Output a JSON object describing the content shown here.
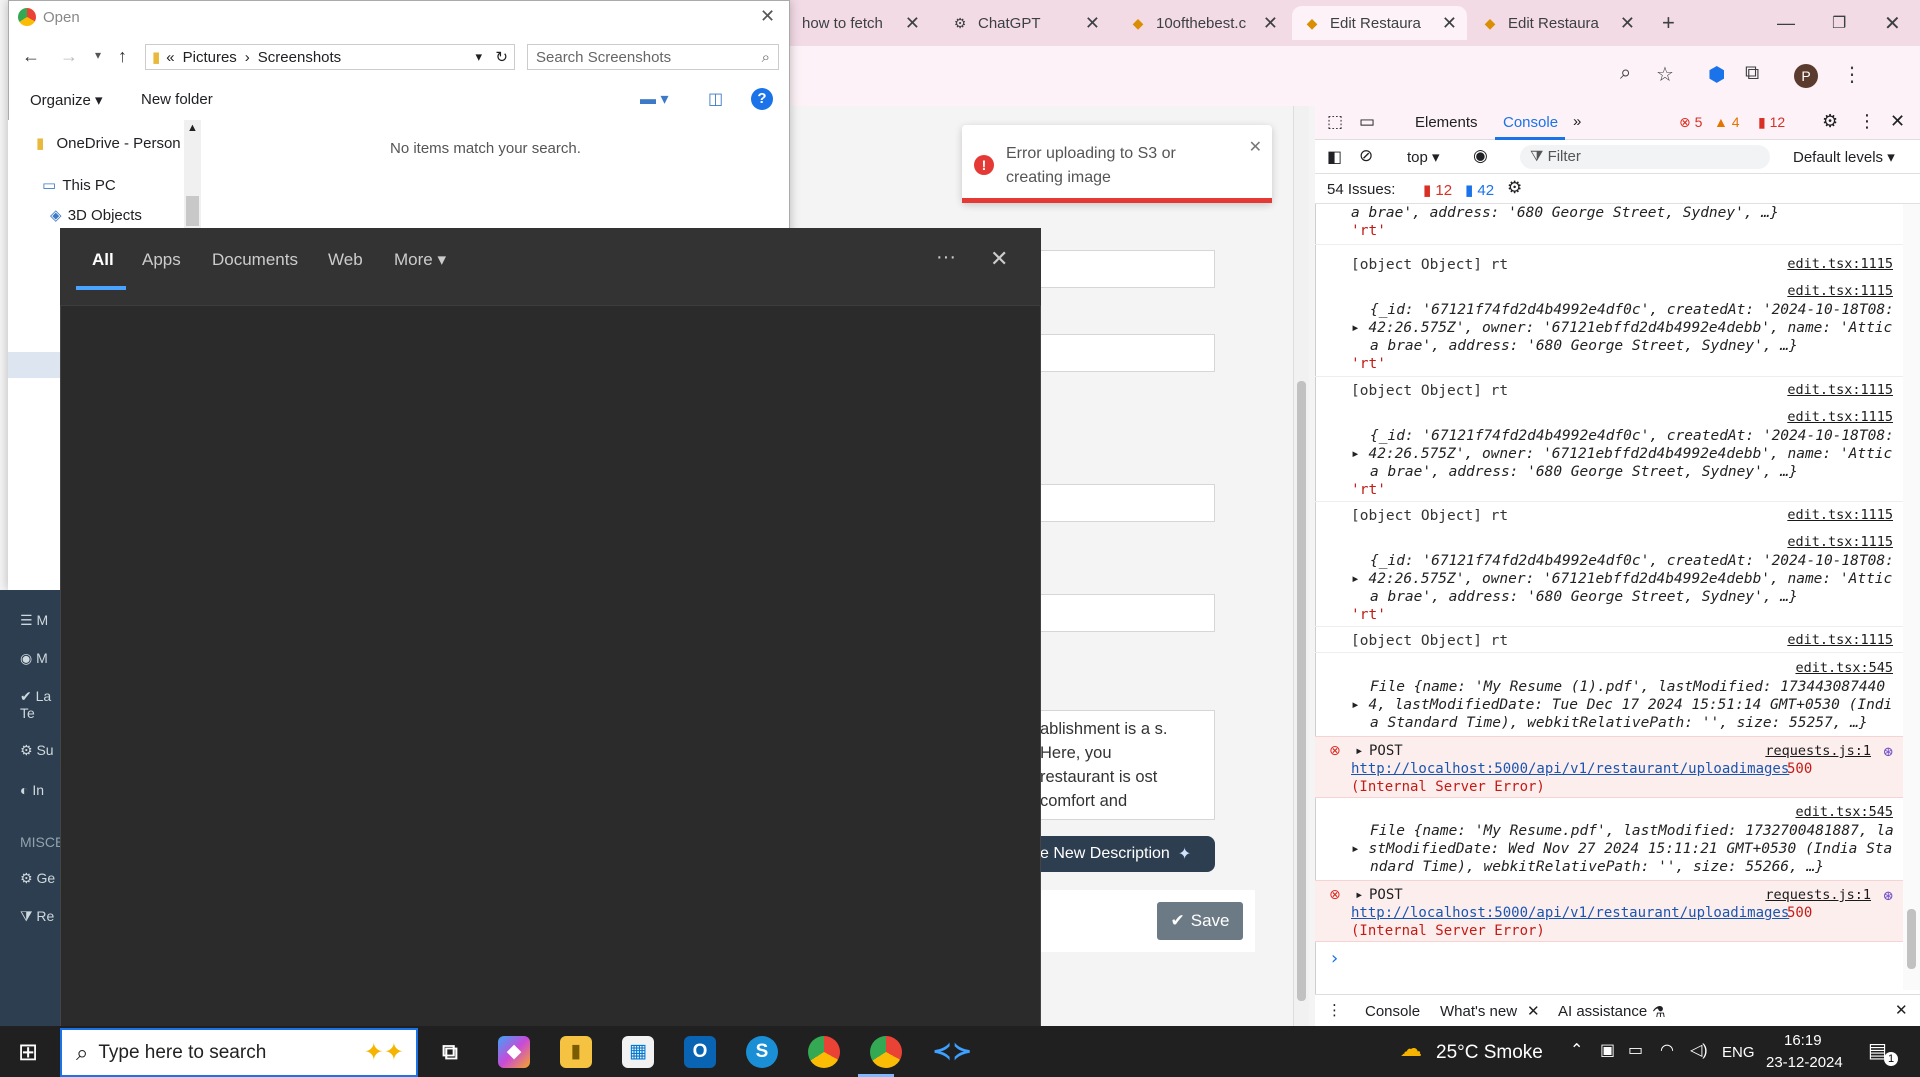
{
  "browser": {
    "tabs": [
      {
        "label": "how to fetch",
        "active": false
      },
      {
        "label": "ChatGPT",
        "active": false
      },
      {
        "label": "10ofthebest.c",
        "active": false
      },
      {
        "label": "Edit Restaura",
        "active": true
      },
      {
        "label": "Edit Restaura",
        "active": false
      }
    ],
    "new_tab": "+",
    "profile_initial": "P"
  },
  "page": {
    "description_text": "ablishment is a s. Here, you restaurant is ost comfort and",
    "generate_button": "e New Description",
    "save_button": "Save"
  },
  "toast": {
    "message": "Error uploading to S3 or creating image"
  },
  "devtools": {
    "tabs": [
      "Elements",
      "Console"
    ],
    "active_tab": "Console",
    "badges": {
      "errors": "5",
      "warnings": "4",
      "issues_count": "12"
    },
    "context": "top",
    "filter_placeholder": "Filter",
    "levels": "Default levels",
    "issues_label": "54 Issues:",
    "issues_errors": "12",
    "issues_info": "42",
    "drawer_tabs": [
      "Console",
      "What's new",
      "AI assistance"
    ]
  },
  "console": {
    "top_partial": "a brae', address: '680 George Street, Sydney', …}",
    "obj_line": "[object Object] rt",
    "src_edit_1115": "edit.tsx:1115",
    "src_edit_545": "edit.tsx:545",
    "src_requests": "requests.js:1",
    "rec_line1a": "{_id: '67121f74fd2d4b4992e4df0c', createdAt: '2024-10-18T08:",
    "rec_line2": "42:26.575Z', owner: '67121ebffd2d4b4992e4debb', name: 'Attic",
    "rec_line3": "a brae', address: '680 George Street, Sydney', …}",
    "rt": "'rt'",
    "file1_l1": "File {name: 'My Resume (1).pdf', lastModified: 173443087440",
    "file1_l2": "4, lastModifiedDate: Tue Dec 17 2024 15:51:14 GMT+0530 (Indi",
    "file1_l3": "a Standard Time), webkitRelativePath: '', size: 55257, …}",
    "post": "POST",
    "url": "http://localhost:5000/api/v1/restaurant/uploadimages",
    "status": "500",
    "ise": "(Internal Server Error)",
    "file2_l1": "File {name: 'My Resume.pdf', lastModified: 1732700481887, la",
    "file2_l2": "stModifiedDate: Wed Nov 27 2024 15:11:21 GMT+0530 (India Sta",
    "file2_l3": "ndard Time), webkitRelativePath: '', size: 55266, …}",
    "prompt": "›"
  },
  "dialog": {
    "title": "Open",
    "path": [
      "Pictures",
      "Screenshots"
    ],
    "search_placeholder": "Search Screenshots",
    "organize": "Organize",
    "new_folder": "New folder",
    "nav": [
      "OneDrive - Person",
      "This PC",
      "3D Objects"
    ],
    "empty_message": "No items match your search."
  },
  "left_app": {
    "items": [
      "M",
      "M",
      "La Te",
      "Su",
      "In",
      "MISCE",
      "Ge",
      "Re"
    ]
  },
  "search_flyout": {
    "tabs": [
      "All",
      "Apps",
      "Documents",
      "Web",
      "More"
    ],
    "active_tab": "All"
  },
  "taskbar": {
    "search_placeholder": "Type here to search",
    "weather": "25°C Smoke",
    "lang": "ENG",
    "time": "16:19",
    "date": "23-12-2024",
    "notif_count": "1"
  }
}
